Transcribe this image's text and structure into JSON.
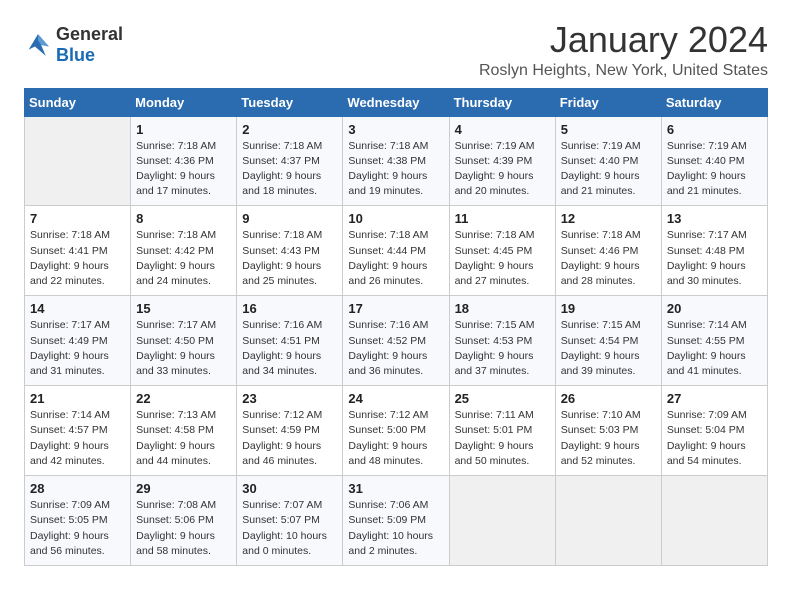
{
  "header": {
    "logo_general": "General",
    "logo_blue": "Blue",
    "title": "January 2024",
    "subtitle": "Roslyn Heights, New York, United States"
  },
  "weekdays": [
    "Sunday",
    "Monday",
    "Tuesday",
    "Wednesday",
    "Thursday",
    "Friday",
    "Saturday"
  ],
  "weeks": [
    [
      {
        "day": "",
        "sunrise": "",
        "sunset": "",
        "daylight": ""
      },
      {
        "day": "1",
        "sunrise": "Sunrise: 7:18 AM",
        "sunset": "Sunset: 4:36 PM",
        "daylight": "Daylight: 9 hours and 17 minutes."
      },
      {
        "day": "2",
        "sunrise": "Sunrise: 7:18 AM",
        "sunset": "Sunset: 4:37 PM",
        "daylight": "Daylight: 9 hours and 18 minutes."
      },
      {
        "day": "3",
        "sunrise": "Sunrise: 7:18 AM",
        "sunset": "Sunset: 4:38 PM",
        "daylight": "Daylight: 9 hours and 19 minutes."
      },
      {
        "day": "4",
        "sunrise": "Sunrise: 7:19 AM",
        "sunset": "Sunset: 4:39 PM",
        "daylight": "Daylight: 9 hours and 20 minutes."
      },
      {
        "day": "5",
        "sunrise": "Sunrise: 7:19 AM",
        "sunset": "Sunset: 4:40 PM",
        "daylight": "Daylight: 9 hours and 21 minutes."
      },
      {
        "day": "6",
        "sunrise": "Sunrise: 7:19 AM",
        "sunset": "Sunset: 4:40 PM",
        "daylight": "Daylight: 9 hours and 21 minutes."
      }
    ],
    [
      {
        "day": "7",
        "sunrise": "Sunrise: 7:18 AM",
        "sunset": "Sunset: 4:41 PM",
        "daylight": "Daylight: 9 hours and 22 minutes."
      },
      {
        "day": "8",
        "sunrise": "Sunrise: 7:18 AM",
        "sunset": "Sunset: 4:42 PM",
        "daylight": "Daylight: 9 hours and 24 minutes."
      },
      {
        "day": "9",
        "sunrise": "Sunrise: 7:18 AM",
        "sunset": "Sunset: 4:43 PM",
        "daylight": "Daylight: 9 hours and 25 minutes."
      },
      {
        "day": "10",
        "sunrise": "Sunrise: 7:18 AM",
        "sunset": "Sunset: 4:44 PM",
        "daylight": "Daylight: 9 hours and 26 minutes."
      },
      {
        "day": "11",
        "sunrise": "Sunrise: 7:18 AM",
        "sunset": "Sunset: 4:45 PM",
        "daylight": "Daylight: 9 hours and 27 minutes."
      },
      {
        "day": "12",
        "sunrise": "Sunrise: 7:18 AM",
        "sunset": "Sunset: 4:46 PM",
        "daylight": "Daylight: 9 hours and 28 minutes."
      },
      {
        "day": "13",
        "sunrise": "Sunrise: 7:17 AM",
        "sunset": "Sunset: 4:48 PM",
        "daylight": "Daylight: 9 hours and 30 minutes."
      }
    ],
    [
      {
        "day": "14",
        "sunrise": "Sunrise: 7:17 AM",
        "sunset": "Sunset: 4:49 PM",
        "daylight": "Daylight: 9 hours and 31 minutes."
      },
      {
        "day": "15",
        "sunrise": "Sunrise: 7:17 AM",
        "sunset": "Sunset: 4:50 PM",
        "daylight": "Daylight: 9 hours and 33 minutes."
      },
      {
        "day": "16",
        "sunrise": "Sunrise: 7:16 AM",
        "sunset": "Sunset: 4:51 PM",
        "daylight": "Daylight: 9 hours and 34 minutes."
      },
      {
        "day": "17",
        "sunrise": "Sunrise: 7:16 AM",
        "sunset": "Sunset: 4:52 PM",
        "daylight": "Daylight: 9 hours and 36 minutes."
      },
      {
        "day": "18",
        "sunrise": "Sunrise: 7:15 AM",
        "sunset": "Sunset: 4:53 PM",
        "daylight": "Daylight: 9 hours and 37 minutes."
      },
      {
        "day": "19",
        "sunrise": "Sunrise: 7:15 AM",
        "sunset": "Sunset: 4:54 PM",
        "daylight": "Daylight: 9 hours and 39 minutes."
      },
      {
        "day": "20",
        "sunrise": "Sunrise: 7:14 AM",
        "sunset": "Sunset: 4:55 PM",
        "daylight": "Daylight: 9 hours and 41 minutes."
      }
    ],
    [
      {
        "day": "21",
        "sunrise": "Sunrise: 7:14 AM",
        "sunset": "Sunset: 4:57 PM",
        "daylight": "Daylight: 9 hours and 42 minutes."
      },
      {
        "day": "22",
        "sunrise": "Sunrise: 7:13 AM",
        "sunset": "Sunset: 4:58 PM",
        "daylight": "Daylight: 9 hours and 44 minutes."
      },
      {
        "day": "23",
        "sunrise": "Sunrise: 7:12 AM",
        "sunset": "Sunset: 4:59 PM",
        "daylight": "Daylight: 9 hours and 46 minutes."
      },
      {
        "day": "24",
        "sunrise": "Sunrise: 7:12 AM",
        "sunset": "Sunset: 5:00 PM",
        "daylight": "Daylight: 9 hours and 48 minutes."
      },
      {
        "day": "25",
        "sunrise": "Sunrise: 7:11 AM",
        "sunset": "Sunset: 5:01 PM",
        "daylight": "Daylight: 9 hours and 50 minutes."
      },
      {
        "day": "26",
        "sunrise": "Sunrise: 7:10 AM",
        "sunset": "Sunset: 5:03 PM",
        "daylight": "Daylight: 9 hours and 52 minutes."
      },
      {
        "day": "27",
        "sunrise": "Sunrise: 7:09 AM",
        "sunset": "Sunset: 5:04 PM",
        "daylight": "Daylight: 9 hours and 54 minutes."
      }
    ],
    [
      {
        "day": "28",
        "sunrise": "Sunrise: 7:09 AM",
        "sunset": "Sunset: 5:05 PM",
        "daylight": "Daylight: 9 hours and 56 minutes."
      },
      {
        "day": "29",
        "sunrise": "Sunrise: 7:08 AM",
        "sunset": "Sunset: 5:06 PM",
        "daylight": "Daylight: 9 hours and 58 minutes."
      },
      {
        "day": "30",
        "sunrise": "Sunrise: 7:07 AM",
        "sunset": "Sunset: 5:07 PM",
        "daylight": "Daylight: 10 hours and 0 minutes."
      },
      {
        "day": "31",
        "sunrise": "Sunrise: 7:06 AM",
        "sunset": "Sunset: 5:09 PM",
        "daylight": "Daylight: 10 hours and 2 minutes."
      },
      {
        "day": "",
        "sunrise": "",
        "sunset": "",
        "daylight": ""
      },
      {
        "day": "",
        "sunrise": "",
        "sunset": "",
        "daylight": ""
      },
      {
        "day": "",
        "sunrise": "",
        "sunset": "",
        "daylight": ""
      }
    ]
  ]
}
